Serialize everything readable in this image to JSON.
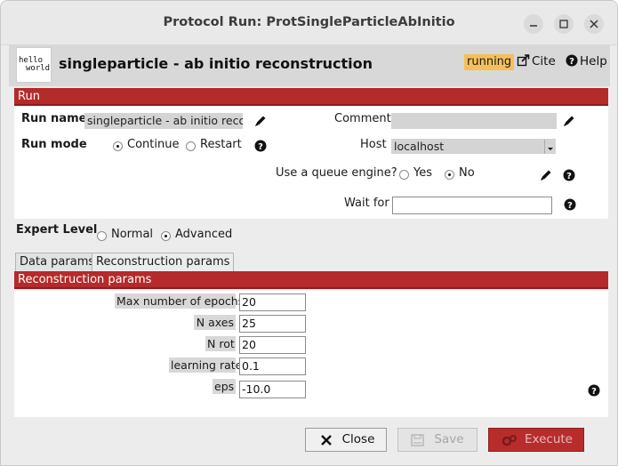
{
  "window": {
    "title": "Protocol Run: ProtSingleParticleAbInitio"
  },
  "header": {
    "logo_lines": [
      "hello",
      "world"
    ],
    "protocol_title": "singleparticle - ab initio reconstruction",
    "status": "running",
    "cite_label": "Cite",
    "help_label": "Help"
  },
  "run_section": {
    "title": "Run",
    "run_name_label": "Run name",
    "run_name_value": "singleparticle - ab initio reconst",
    "comment_label": "Comment",
    "comment_value": "",
    "run_mode_label": "Run mode",
    "run_mode_options": [
      "Continue",
      "Restart"
    ],
    "run_mode_selected": "Continue",
    "host_label": "Host",
    "host_value": "localhost",
    "queue_label": "Use a queue engine?",
    "queue_options": [
      "Yes",
      "No"
    ],
    "queue_selected": "No",
    "wait_for_label": "Wait for",
    "wait_for_value": ""
  },
  "expert_level": {
    "label": "Expert Level",
    "options": [
      "Normal",
      "Advanced"
    ],
    "selected": "Advanced"
  },
  "tabs": [
    {
      "label": "Data params",
      "active": false
    },
    {
      "label": "Reconstruction params",
      "active": true
    }
  ],
  "reconstruction_params": {
    "title": "Reconstruction params",
    "fields": [
      {
        "label": "Max number of epochs",
        "value": "20"
      },
      {
        "label": "N axes",
        "value": "25"
      },
      {
        "label": "N rot",
        "value": "20"
      },
      {
        "label": "learning rate",
        "value": "0.1"
      },
      {
        "label": "eps",
        "value": "-10.0"
      }
    ]
  },
  "footer": {
    "close_label": "Close",
    "save_label": "Save",
    "execute_label": "Execute"
  },
  "colors": {
    "accent_red": "#b52a2a",
    "status_bg": "#f5c05a"
  }
}
